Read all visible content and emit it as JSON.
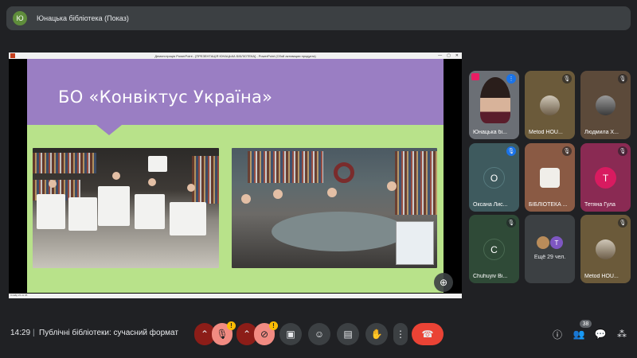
{
  "topbar": {
    "badge": "Ю",
    "title": "Юнацька бібліотека (Показ)"
  },
  "presentation": {
    "window_title": "Демонстрація PowerPoint - [ПРЕЗЕНТАЦІЯ ЮНАЦЬКА БІБЛІОТЕКА] - PowerPoint (Сбой активации продукта)",
    "slide_title": "БО «Конвіктус Україна»",
    "status": "Слайд 21 из 46"
  },
  "participants": [
    {
      "name": "Юнацька бі...",
      "type": "video",
      "color": "#5f6368"
    },
    {
      "name": "Metod HOU...",
      "type": "thumb",
      "color": "#6b5a3a",
      "muted": true
    },
    {
      "name": "Людмила Х...",
      "type": "thumb",
      "color": "#5c4a3a",
      "muted": true
    },
    {
      "name": "Оксана Лис...",
      "type": "avatar",
      "initial": "О",
      "color": "#3e5a5e",
      "avatar_color": "#3e5a5e",
      "muted": true
    },
    {
      "name": "БІБЛІОТЕКА ...",
      "type": "logo",
      "color": "#8a5a44",
      "muted": true
    },
    {
      "name": "Тетяна Гула",
      "type": "avatar",
      "initial": "Т",
      "color": "#8a2a53",
      "avatar_color": "#d81b60",
      "muted": true
    },
    {
      "name": "Chuhuyiv Bi...",
      "type": "avatar",
      "initial": "C",
      "color": "#2f4a37",
      "avatar_color": "#2f4a37",
      "muted": true
    },
    {
      "name": "Ещё 29 чел.",
      "type": "more",
      "color": "#3c4043"
    },
    {
      "name": "Metod HOU...",
      "type": "thumb",
      "color": "#6b5a3a",
      "muted": true
    }
  ],
  "bottombar": {
    "time": "14:29",
    "separator": "|",
    "meeting_title": "Публічні бібліотеки: сучасний формат",
    "participant_count": "38"
  },
  "icons": {
    "mic_off": "mic-off-icon",
    "cam_off": "camera-off-icon",
    "present": "present-icon",
    "emoji": "emoji-icon",
    "captions": "captions-icon",
    "hand": "raise-hand-icon",
    "more": "more-icon",
    "hangup": "hangup-icon",
    "info": "info-icon",
    "people": "people-icon",
    "chat": "chat-icon",
    "activities": "activities-icon"
  },
  "colors": {
    "accent_red": "#ea4335",
    "warn": "#fbbc04",
    "slide_purple": "#9a7ec3",
    "slide_green": "#b8e28a"
  }
}
